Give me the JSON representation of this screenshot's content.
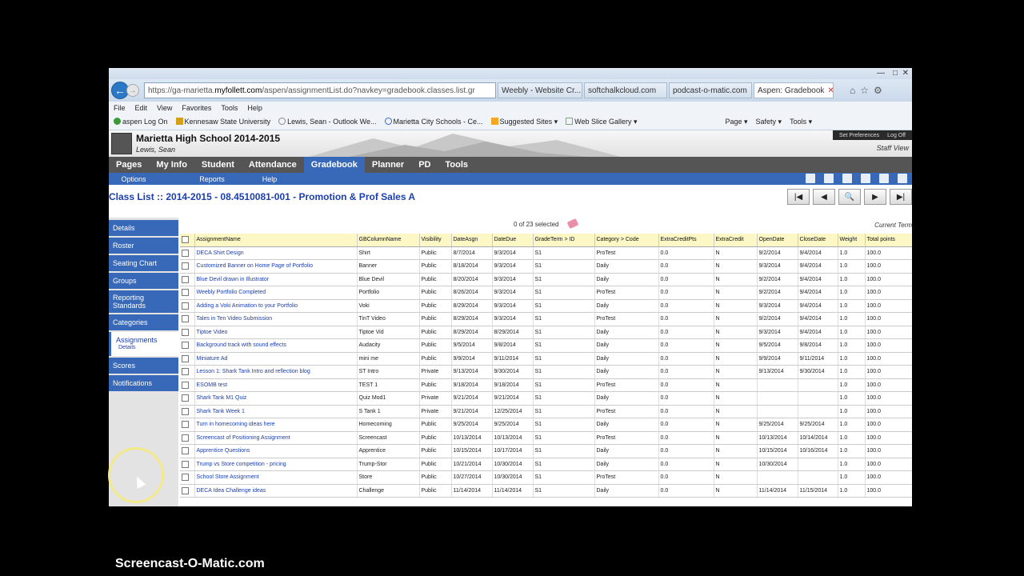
{
  "browser": {
    "url_prefix": "https://ga-marietta.",
    "url_domain": "myfollett.com",
    "url_rest": "/aspen/assignmentList.do?navkey=gradebook.classes.list.gr",
    "tabs": [
      "Weebly - Website Cr...",
      "softchalkcloud.com",
      "podcast-o-matic.com",
      "Aspen: Gradebook"
    ],
    "menu": [
      "File",
      "Edit",
      "View",
      "Favorites",
      "Tools",
      "Help"
    ],
    "favorites": [
      "aspen Log On",
      "Kennesaw State University",
      "Lewis, Sean - Outlook We...",
      "Marietta City Schools - Ce...",
      "Suggested Sites ▾",
      "Web Slice Gallery ▾"
    ],
    "commands": [
      "Page ▾",
      "Safety ▾",
      "Tools ▾"
    ]
  },
  "header": {
    "school": "Marietta High School 2014-2015",
    "user": "Lewis, Sean",
    "set_prefs": "Set Preferences",
    "log_off": "Log Off",
    "staff_view": "Staff View"
  },
  "topnav": [
    "Pages",
    "My Info",
    "Student",
    "Attendance",
    "Gradebook",
    "Planner",
    "PD",
    "Tools"
  ],
  "subnav": [
    "Options",
    "Reports",
    "Help"
  ],
  "page_title": "Class List :: 2014-2015 - 08.4510081-001 - Promotion & Prof Sales A",
  "side": {
    "details": "Details",
    "roster": "Roster",
    "seating": "Seating Chart",
    "groups": "Groups",
    "reporting1": "Reporting",
    "reporting2": "Standards",
    "categories": "Categories",
    "assignments": "Assignments",
    "assignments_sub": "Details",
    "scores": "Scores",
    "notifications": "Notifications"
  },
  "selected_count": "0 of 23 selected",
  "current_term": "Current Term",
  "columns": [
    "AssignmentName",
    "GBColumnName",
    "Visibility",
    "DateAsgn",
    "DateDue",
    "GradeTerm > ID",
    "Category > Code",
    "ExtraCreditPts",
    "ExtraCredit",
    "OpenDate",
    "CloseDate",
    "Weight",
    "Total points"
  ],
  "rows": [
    [
      "DECA Shirt Design",
      "Shirt",
      "Public",
      "8/7/2014",
      "9/3/2014",
      "S1",
      "ProTest",
      "0.0",
      "N",
      "9/2/2014",
      "9/4/2014",
      "1.0",
      "100.0"
    ],
    [
      "Customized Banner on Home Page of Portfolio",
      "Banner",
      "Public",
      "8/18/2014",
      "9/3/2014",
      "S1",
      "Daily",
      "0.0",
      "N",
      "9/3/2014",
      "9/4/2014",
      "1.0",
      "100.0"
    ],
    [
      "Blue Devil drawn in Illustrator",
      "Blue Devil",
      "Public",
      "8/20/2014",
      "9/3/2014",
      "S1",
      "Daily",
      "0.0",
      "N",
      "9/2/2014",
      "9/4/2014",
      "1.0",
      "100.0"
    ],
    [
      "Weebly Portfolio Completed",
      "Portfolio",
      "Public",
      "8/26/2014",
      "9/3/2014",
      "S1",
      "ProTest",
      "0.0",
      "N",
      "9/2/2014",
      "9/4/2014",
      "1.0",
      "100.0"
    ],
    [
      "Adding a Voki Animation to your Portfolio",
      "Voki",
      "Public",
      "8/29/2014",
      "9/3/2014",
      "S1",
      "Daily",
      "0.0",
      "N",
      "9/3/2014",
      "9/4/2014",
      "1.0",
      "100.0"
    ],
    [
      "Tales in Ten Video Submission",
      "TinT Video",
      "Public",
      "8/29/2014",
      "9/3/2014",
      "S1",
      "ProTest",
      "0.0",
      "N",
      "9/2/2014",
      "9/4/2014",
      "1.0",
      "100.0"
    ],
    [
      "Tiptoe Video",
      "Tiptoe Vid",
      "Public",
      "8/29/2014",
      "8/29/2014",
      "S1",
      "Daily",
      "0.0",
      "N",
      "9/3/2014",
      "9/4/2014",
      "1.0",
      "100.0"
    ],
    [
      "Background track with sound effects",
      "Audacity",
      "Public",
      "9/5/2014",
      "9/8/2014",
      "S1",
      "Daily",
      "0.0",
      "N",
      "9/5/2014",
      "9/8/2014",
      "1.0",
      "100.0"
    ],
    [
      "Miniature Ad",
      "mini me",
      "Public",
      "9/9/2014",
      "9/11/2014",
      "S1",
      "Daily",
      "0.0",
      "N",
      "9/9/2014",
      "9/11/2014",
      "1.0",
      "100.0"
    ],
    [
      "Lesson 1: Shark Tank Intro and reflection blog",
      "ST Intro",
      "Private",
      "9/13/2014",
      "9/30/2014",
      "S1",
      "Daily",
      "0.0",
      "N",
      "9/13/2014",
      "9/30/2014",
      "1.0",
      "100.0"
    ],
    [
      "ESOMB test",
      "TEST 1",
      "Public",
      "9/18/2014",
      "9/18/2014",
      "S1",
      "ProTest",
      "0.0",
      "N",
      "",
      "",
      "1.0",
      "100.0"
    ],
    [
      "Shark Tank M1 Quiz",
      "Quiz Mod1",
      "Private",
      "9/21/2014",
      "9/21/2014",
      "S1",
      "Daily",
      "0.0",
      "N",
      "",
      "",
      "1.0",
      "100.0"
    ],
    [
      "Shark Tank Week 1",
      "S Tank 1",
      "Private",
      "9/21/2014",
      "12/25/2014",
      "S1",
      "ProTest",
      "0.0",
      "N",
      "",
      "",
      "1.0",
      "100.0"
    ],
    [
      "Turn in homecoming ideas here",
      "Homecoming",
      "Public",
      "9/25/2014",
      "9/25/2014",
      "S1",
      "Daily",
      "0.0",
      "N",
      "9/25/2014",
      "9/25/2014",
      "1.0",
      "100.0"
    ],
    [
      "Screencast of Positioning Assignment",
      "Screencast",
      "Public",
      "10/13/2014",
      "10/13/2014",
      "S1",
      "ProTest",
      "0.0",
      "N",
      "10/13/2014",
      "10/14/2014",
      "1.0",
      "100.0"
    ],
    [
      "Apprentice Questions",
      "Apprentice",
      "Public",
      "10/15/2014",
      "10/17/2014",
      "S1",
      "Daily",
      "0.0",
      "N",
      "10/15/2014",
      "10/16/2014",
      "1.0",
      "100.0"
    ],
    [
      "Trump vs Store competition - pricing",
      "Trump-Stor",
      "Public",
      "10/21/2014",
      "10/30/2014",
      "S1",
      "Daily",
      "0.0",
      "N",
      "10/30/2014",
      "",
      "1.0",
      "100.0"
    ],
    [
      "School Store Assignment",
      "Store",
      "Public",
      "10/27/2014",
      "10/30/2014",
      "S1",
      "ProTest",
      "0.0",
      "N",
      "",
      "",
      "1.0",
      "100.0"
    ],
    [
      "DECA Idea Challenge ideas",
      "Challenge",
      "Public",
      "11/14/2014",
      "11/14/2014",
      "S1",
      "Daily",
      "0.0",
      "N",
      "11/14/2014",
      "11/15/2014",
      "1.0",
      "100.0"
    ]
  ],
  "watermark": "Screencast-O-Matic.com"
}
